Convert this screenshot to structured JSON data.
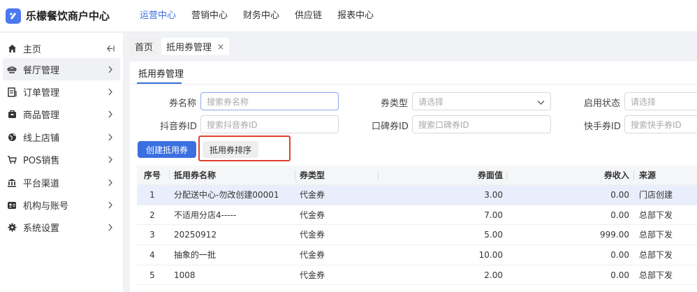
{
  "app": {
    "title": "乐檬餐饮商户中心",
    "top_nav": [
      "运营中心",
      "营销中心",
      "财务中心",
      "供应链",
      "报表中心"
    ],
    "top_nav_active": 0,
    "accent": "#3b6fe0"
  },
  "sidebar": {
    "items": [
      {
        "label": "主页",
        "icon": "home-icon"
      },
      {
        "label": "餐厅管理",
        "icon": "restaurant-icon"
      },
      {
        "label": "订单管理",
        "icon": "order-icon"
      },
      {
        "label": "商品管理",
        "icon": "goods-icon"
      },
      {
        "label": "线上店铺",
        "icon": "globe-icon"
      },
      {
        "label": "POS销售",
        "icon": "pos-icon"
      },
      {
        "label": "平台渠道",
        "icon": "bank-icon"
      },
      {
        "label": "机构与账号",
        "icon": "account-icon"
      },
      {
        "label": "系统设置",
        "icon": "gear-icon"
      }
    ]
  },
  "tabs": [
    {
      "label": "首页"
    },
    {
      "label": "抵用券管理",
      "close": "×"
    }
  ],
  "panel": {
    "title": "抵用券管理",
    "filters": {
      "coupon_name": {
        "label": "券名称",
        "placeholder": "搜索券名称"
      },
      "coupon_type": {
        "label": "券类型",
        "placeholder": "请选择"
      },
      "enable_status": {
        "label": "启用状态",
        "placeholder": "请选择"
      },
      "douyin_id": {
        "label": "抖音券ID",
        "placeholder": "搜索抖音券ID"
      },
      "koubei_id": {
        "label": "口碑券ID",
        "placeholder": "搜索口碑券ID"
      },
      "kuaishou_id": {
        "label": "快手券ID",
        "placeholder": "搜索快手券ID"
      }
    },
    "create_button": "创建抵用券",
    "sort_button": "抵用券排序"
  },
  "table": {
    "headers": [
      "序号",
      "抵用券名称",
      "券类型",
      "券面值",
      "券收入",
      "来源"
    ],
    "rows": [
      {
        "no": "1",
        "name": "分配送中心-勿改创建00001",
        "type": "代金券",
        "face": "3.00",
        "income": "0.00",
        "source": "门店创建"
      },
      {
        "no": "2",
        "name": "不适用分店4-----",
        "type": "代金券",
        "face": "7.00",
        "income": "0.00",
        "source": "总部下发"
      },
      {
        "no": "3",
        "name": "20250912",
        "type": "代金券",
        "face": "5.00",
        "income": "999.00",
        "source": "总部下发"
      },
      {
        "no": "4",
        "name": "抽象的一批",
        "type": "代金券",
        "face": "10.00",
        "income": "0.00",
        "source": "总部下发"
      },
      {
        "no": "5",
        "name": "1008",
        "type": "代金券",
        "face": "2.00",
        "income": "0.00",
        "source": "总部下发"
      }
    ]
  }
}
